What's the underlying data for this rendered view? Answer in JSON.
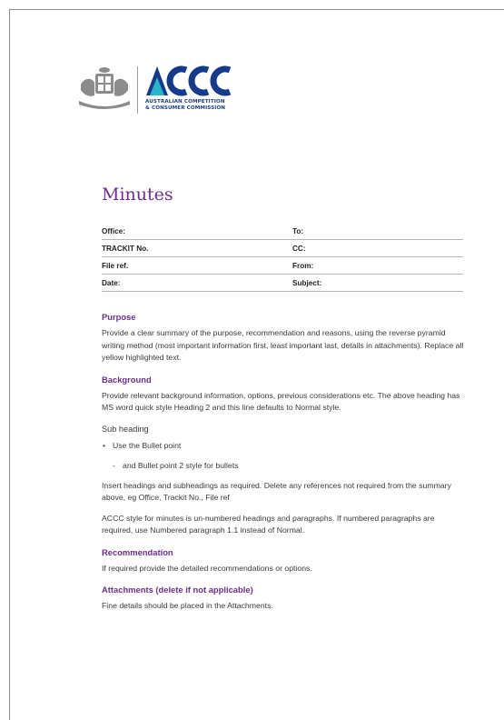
{
  "logo": {
    "acronym": "ACCC",
    "subtitle_line1": "AUSTRALIAN COMPETITION",
    "subtitle_line2": "& CONSUMER COMMISSION",
    "colors": {
      "navy": "#163a8a",
      "teal": "#29b6c8",
      "purple": "#6b2e8f"
    }
  },
  "document": {
    "title": "Minutes",
    "meta": [
      {
        "left": "Office:",
        "right": "To:"
      },
      {
        "left": "TRACKIT No.",
        "right": "CC:"
      },
      {
        "left": "File ref.",
        "right": "From:"
      },
      {
        "left": "Date:",
        "right": "Subject:"
      }
    ]
  },
  "sections": {
    "purpose": {
      "heading": "Purpose",
      "body": "Provide a clear summary of the purpose, recommendation and reasons, using the reverse pyramid writing method (most important information first, least important last, details in attachments). Replace all yellow highlighted text."
    },
    "background": {
      "heading": "Background",
      "body": "Provide relevant background information, options, previous considerations etc. The above heading has MS word quick style Heading 2 and this line defaults to Normal style."
    },
    "subheading": {
      "heading": "Sub heading",
      "bullet1": "Use the Bullet point",
      "bullet2": "and Bullet point 2 style for bullets",
      "bullet1_mark": "•",
      "bullet2_mark": "-",
      "para1": "Insert headings and subheadings as required. Delete any references not required from the summary above, eg Office, Trackit No., File ref",
      "para2": "ACCC style for minutes is un-numbered headings and paragraphs. If numbered paragraphs are required, use Numbered paragraph 1.1 instead of Normal."
    },
    "recommendation": {
      "heading": "Recommendation",
      "body": "If required provide the detailed recommendations or options."
    },
    "attachments": {
      "heading": "Attachments (delete if not applicable)",
      "body": "Fine details should be placed in the Attachments."
    }
  }
}
